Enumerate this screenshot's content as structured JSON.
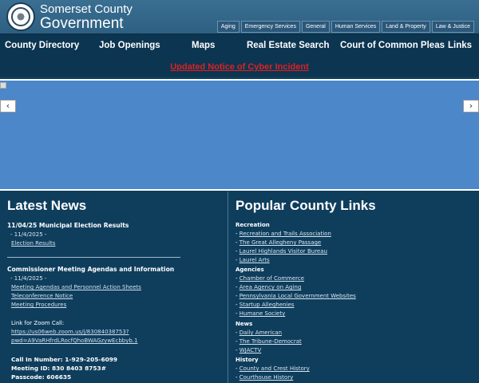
{
  "header": {
    "brand_line1": "Somerset County",
    "brand_line2": "Government",
    "utility_nav": [
      "Aging",
      "Emergency Services",
      "General",
      "Human Services",
      "Land & Property",
      "Law & Justice"
    ]
  },
  "main_nav": [
    "County Directory",
    "Job Openings",
    "Maps",
    "Real Estate Search",
    "Court of Common Pleas",
    "Links"
  ],
  "alert": "Updated Notice of Cyber Incident",
  "carousel": {
    "prev": "‹",
    "next": "›"
  },
  "latest_news": {
    "heading": "Latest News",
    "item1": {
      "title": "11/04/25 Municipal Election Results",
      "date": "- 11/4/2025 -",
      "link": "Election Results"
    },
    "item2": {
      "title": "Commissioner Meeting Agendas and Information",
      "date": "- 11/4/2025 -",
      "links": [
        "Meeting Agendas and Personnel Action Sheets",
        "Teleconference Notice",
        "Meeting Procedures"
      ],
      "zoom_label": "Link for Zoom Call:",
      "zoom_url_1": "https://us06web.zoom.us/j/83084038753?",
      "zoom_url_2": "pwd=A9VaRHfrdLRocfQhoBWAGzywEcbbyb.1",
      "call_in": "Call In Number:  1-929-205-6099",
      "meeting_id": "Meeting ID:  830 8403 8753#",
      "passcode": "Passcode:  606635"
    }
  },
  "popular_links": {
    "heading": "Popular County Links",
    "recreation": {
      "label": "Recreation",
      "links": [
        "Recreation and Trails Association",
        "The Great Allegheny Passage",
        "Laurel Highlands Visitor Bureau",
        "Laurel Arts"
      ]
    },
    "agencies": {
      "label": "Agencies",
      "links": [
        "Chamber of Commerce",
        "Area Agency on Aging",
        "Pennsylvania Local Government Websites",
        "Startup Alleghenies",
        "Humane Society"
      ]
    },
    "news": {
      "label": "News",
      "links": [
        "Daily American",
        "The Tribune-Democrat",
        "WJACTV"
      ]
    },
    "history": {
      "label": "History",
      "links": [
        "County and Crest History",
        "Courthouse History"
      ]
    }
  },
  "colors": {
    "alert": "#e02020",
    "carousel": "#4c87c9",
    "background": "#0f3e5d"
  }
}
